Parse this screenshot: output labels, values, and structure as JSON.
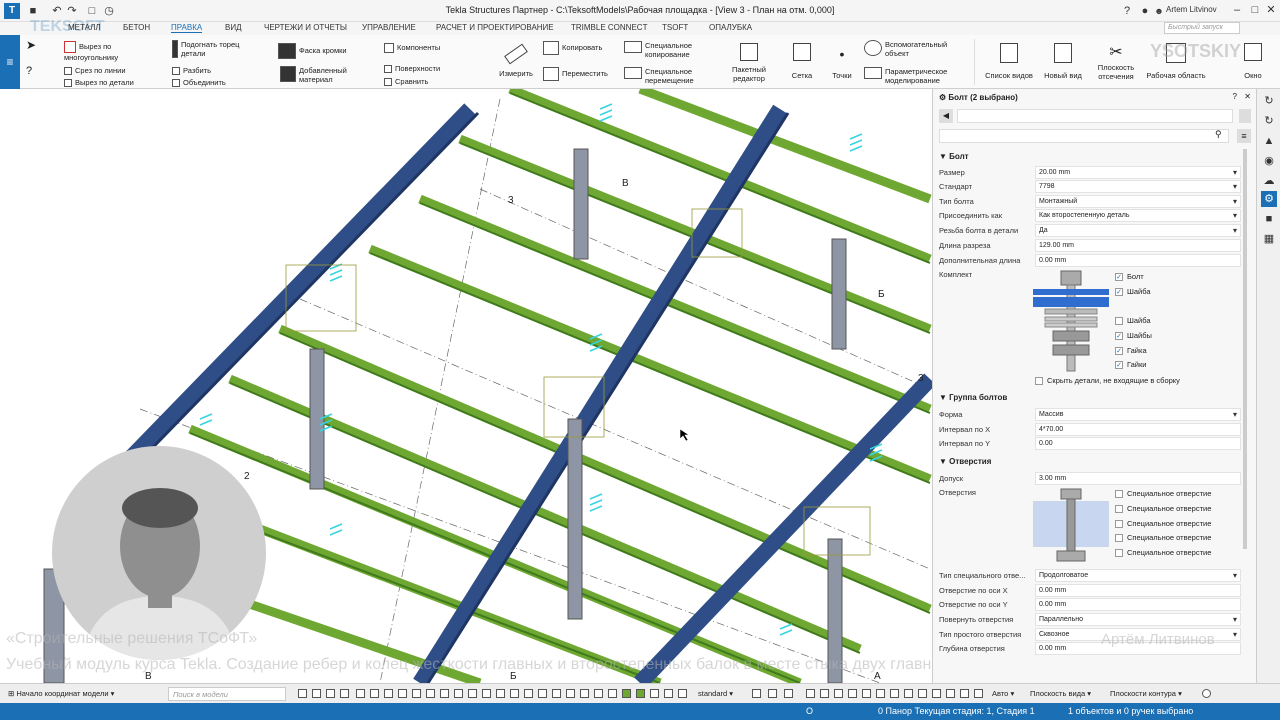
{
  "titlebar": {
    "title": "Tekla Structures Партнер - C:\\TeksoftModels\\Рабочая площадка - [View 3 - План на отм. 0,000]",
    "user": "Artem Litvinov",
    "search_placeholder": "Быстрый запуск",
    "watermark_logo": "TEKSOFT",
    "watermark_logo_right": "YSOTSKIY"
  },
  "tabs": [
    "МЕТАЛЛ",
    "БЕТОН",
    "ПРАВКА",
    "ВИД",
    "ЧЕРТЕЖИ И ОТЧЕТЫ",
    "УПРАВЛЕНИЕ",
    "РАСЧЕТ И ПРОЕКТИРОВАНИЕ",
    "TRIMBLE CONNECT",
    "TSOFT",
    "ОПАЛУБКА"
  ],
  "active_tab": "ПРАВКА",
  "ribbon": {
    "cut_polygon": "Вырез по многоугольнику",
    "cut_line": "Срез по линии",
    "cut_part": "Вырез по детали",
    "fit_end": "Подогнать торец детали",
    "split": "Разбить",
    "combine": "Объединить",
    "chamfer": "Фаска кромки",
    "added_material": "Добавленный материал",
    "components": "Компоненты",
    "surfaces": "Поверхности",
    "compare": "Сравнить",
    "measure": "Измерить",
    "copy": "Копировать",
    "move": "Переместить",
    "special_copy": "Специальное копирование",
    "special_move": "Специальное перемещение",
    "batch_editor": "Пакетный редактор",
    "grid": "Сетка",
    "points": "Точки",
    "helper_object": "Вспомогательный объект",
    "parametric": "Параметрическое моделирование",
    "view_list": "Список видов",
    "new_view": "Новый вид",
    "clip_planes": "Плоскость отсечения",
    "work_area": "Рабочая область",
    "window": "Окно"
  },
  "panel": {
    "header": "Болт (2 выбрано)",
    "bolt_section": "Болт",
    "rows": [
      {
        "label": "Размер",
        "value": "20.00 mm",
        "dd": true
      },
      {
        "label": "Стандарт",
        "value": "7798",
        "dd": true
      },
      {
        "label": "Тип болта",
        "value": "Монтажный",
        "dd": true
      },
      {
        "label": "Присоединить как",
        "value": "Как второстепенную деталь",
        "dd": true
      },
      {
        "label": "Резьба болта в детали",
        "value": "Да",
        "dd": true
      },
      {
        "label": "Длина разреза",
        "value": "129.00 mm",
        "dd": false
      },
      {
        "label": "Дополнительная длина",
        "value": "0.00 mm",
        "dd": false
      }
    ],
    "kit_label": "Комплект",
    "kit_items": [
      {
        "label": "Болт",
        "checked": true
      },
      {
        "label": "Шайба",
        "checked": true
      },
      {
        "label": "Шайба",
        "checked": false
      },
      {
        "label": "Шайбы",
        "checked": true
      },
      {
        "label": "Гайка",
        "checked": true
      },
      {
        "label": "Гайки",
        "checked": true
      }
    ],
    "hide_parts": "Скрыть детали, не входящие в сборку",
    "group_section": "Группа болтов",
    "group_rows": [
      {
        "label": "Форма",
        "value": "Массив",
        "dd": true
      },
      {
        "label": "Интервал по X",
        "value": "4*70.00",
        "dd": false
      },
      {
        "label": "Интервал по Y",
        "value": "0.00",
        "dd": false
      }
    ],
    "holes_section": "Отверстия",
    "tolerance_label": "Допуск",
    "tolerance_value": "3.00 mm",
    "holes_label": "Отверстия",
    "special_hole": [
      "Специальное отверстие",
      "Специальное отверстие",
      "Специальное отверстие",
      "Специальное отверстие",
      "Специальное отверстие"
    ],
    "hole_rows": [
      {
        "label": "Тип специального отве...",
        "value": "Продолговатое",
        "dd": true
      },
      {
        "label": "Отверстие по оси X",
        "value": "0.00 mm",
        "dd": false
      },
      {
        "label": "Отверстие по оси Y",
        "value": "0.00 mm",
        "dd": false
      },
      {
        "label": "Повернуть отверстия",
        "value": "Параллельно",
        "dd": true
      },
      {
        "label": "Тип простого отверстия",
        "value": "Сквозное",
        "dd": true
      },
      {
        "label": "Глубина отверстия",
        "value": "0.00 mm",
        "dd": false
      }
    ]
  },
  "viewport": {
    "grid_labels": [
      "В",
      "3",
      "Б",
      "3",
      "2",
      "В",
      "Б",
      "А"
    ]
  },
  "overlay": {
    "line1": "«Строительные решения ТСоФТ»",
    "line2": "Учебный модуль курса Tekla. Создание ребер и колец жесткости главных и второстепенных балок в месте стыка двух главных балок",
    "author": "Артём Литвинов"
  },
  "bottombar": {
    "origin": "Начало координат модели",
    "search_placeholder": "Поиск в модели",
    "standard": "standard",
    "auto": "Авто",
    "view_plane": "Плоскость вида",
    "contour_plane": "Плоскости контура"
  },
  "statusbar": {
    "o": "O",
    "phase": "0 Панор Текущая стадия: 1, Стадия 1",
    "selected": "1 объектов и 0 ручек выбрано"
  }
}
